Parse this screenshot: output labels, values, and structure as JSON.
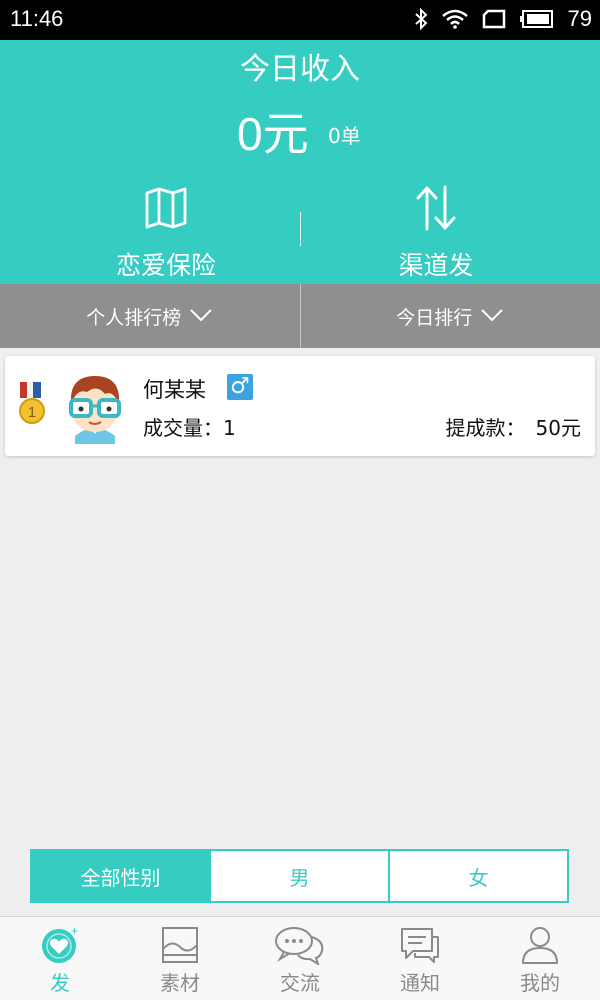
{
  "status_bar": {
    "time": "11:46",
    "battery": "79"
  },
  "header": {
    "title": "今日收入",
    "amount": "0元",
    "orders": "0单",
    "actions": [
      {
        "label": "恋爱保险",
        "icon": "map-icon"
      },
      {
        "label": "渠道发",
        "icon": "swap-arrows-icon"
      }
    ]
  },
  "ranking_bar": {
    "scope": "个人排行榜",
    "period": "今日排行"
  },
  "rank_list": [
    {
      "rank": "1",
      "name": "何某某",
      "gender_symbol": "♂",
      "volume_label": "成交量：",
      "volume": "1",
      "commission_label": "提成款：",
      "commission": "50元"
    }
  ],
  "gender_filter": {
    "options": [
      "全部性别",
      "男",
      "女"
    ],
    "selected": "全部性别"
  },
  "tab_bar": {
    "tabs": [
      {
        "label": "发",
        "icon": "heart-icon"
      },
      {
        "label": "素材",
        "icon": "image-icon"
      },
      {
        "label": "交流",
        "icon": "chat-bubbles-icon"
      },
      {
        "label": "通知",
        "icon": "message-icon"
      },
      {
        "label": "我的",
        "icon": "user-icon"
      }
    ],
    "active": "发"
  },
  "colors": {
    "accent": "#35ccc2",
    "rank_bar": "#8f8f8f",
    "gender_male": "#3aa3e0"
  }
}
